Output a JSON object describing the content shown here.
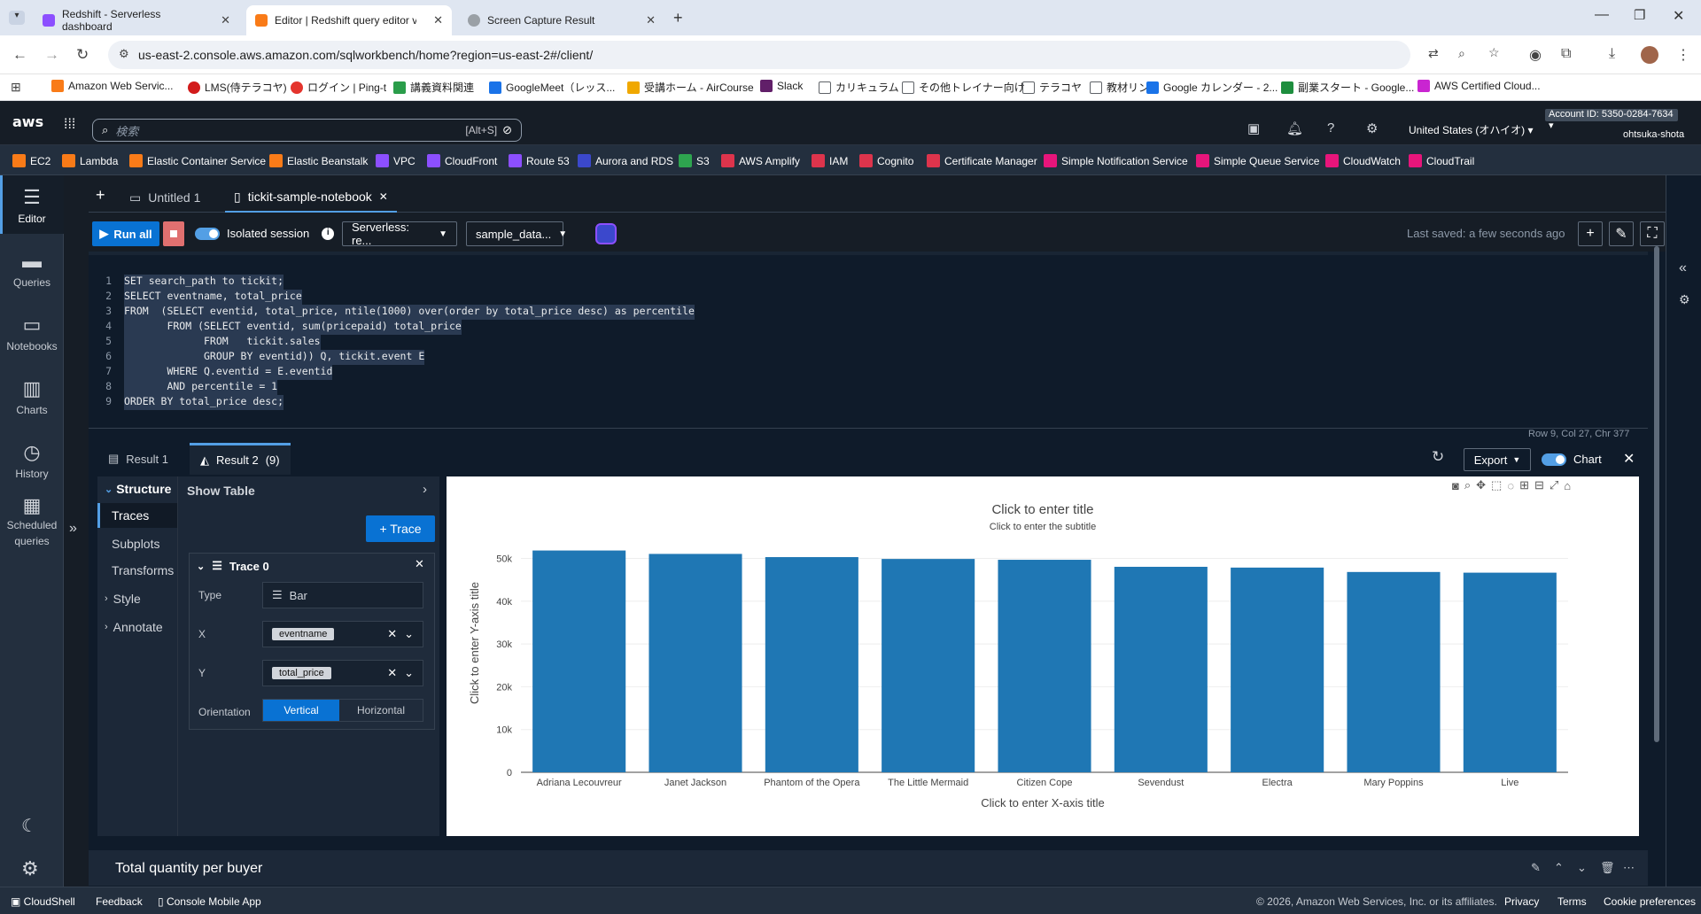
{
  "browser": {
    "tabs": [
      {
        "title": "Redshift - Serverless dashboard",
        "color": "#8c4fff"
      },
      {
        "title": "Editor | Redshift query editor v2",
        "color": "#f97b18"
      },
      {
        "title": "Screen Capture Result",
        "color": "#9aa0a6"
      }
    ],
    "url": "us-east-2.console.aws.amazon.com/sqlworkbench/home?region=us-east-2#/client/"
  },
  "bookmarks": [
    {
      "label": "Amazon Web Servic...",
      "color": "#f97b18"
    },
    {
      "label": "LMS(侍テラコヤ)",
      "color": "#d21b1b"
    },
    {
      "label": "ログイン | Ping-t",
      "color": "#e4342d"
    },
    {
      "label": "講義資料関連",
      "color": "#2a9d4a"
    },
    {
      "label": "GoogleMeet（レッス...",
      "color": "#1a73e8"
    },
    {
      "label": "受講ホーム - AirCourse",
      "color": "#f0a800"
    },
    {
      "label": "Slack",
      "color": "#611f69"
    },
    {
      "label": "カリキュラム",
      "color": "#5f6368"
    },
    {
      "label": "その他トレイナー向け",
      "color": "#5f6368"
    },
    {
      "label": "テラコヤ",
      "color": "#5f6368"
    },
    {
      "label": "教材リンク",
      "color": "#5f6368"
    },
    {
      "label": "Google カレンダー - 2...",
      "color": "#1a73e8"
    },
    {
      "label": "副業スタート - Google...",
      "color": "#1e8e3e"
    },
    {
      "label": "AWS Certified Cloud...",
      "color": "#c925d1"
    }
  ],
  "aws": {
    "search_placeholder": "検索",
    "search_shortcut": "[Alt+S]",
    "region": "United States (オハイオ) ▾",
    "account": "Account ID: 5350-0284-7634 ▾",
    "user": "ohtsuka-shota",
    "services": [
      {
        "label": "EC2",
        "color": "#f97b18"
      },
      {
        "label": "Lambda",
        "color": "#f97b18"
      },
      {
        "label": "Elastic Container Service",
        "color": "#f97b18"
      },
      {
        "label": "Elastic Beanstalk",
        "color": "#f97b18"
      },
      {
        "label": "VPC",
        "color": "#8c4fff"
      },
      {
        "label": "CloudFront",
        "color": "#8c4fff"
      },
      {
        "label": "Route 53",
        "color": "#8c4fff"
      },
      {
        "label": "Aurora and RDS",
        "color": "#3b48cc"
      },
      {
        "label": "S3",
        "color": "#2ea44f"
      },
      {
        "label": "AWS Amplify",
        "color": "#dd344c"
      },
      {
        "label": "IAM",
        "color": "#dd344c"
      },
      {
        "label": "Cognito",
        "color": "#dd344c"
      },
      {
        "label": "Certificate Manager",
        "color": "#dd344c"
      },
      {
        "label": "Simple Notification Service",
        "color": "#e7157b"
      },
      {
        "label": "Simple Queue Service",
        "color": "#e7157b"
      },
      {
        "label": "CloudWatch",
        "color": "#e7157b"
      },
      {
        "label": "CloudTrail",
        "color": "#e7157b"
      }
    ]
  },
  "rail": [
    {
      "label": "Editor",
      "icon": "☰"
    },
    {
      "label": "Queries",
      "icon": "▬"
    },
    {
      "label": "Notebooks",
      "icon": "▭"
    },
    {
      "label": "Charts",
      "icon": "▥"
    },
    {
      "label": "History",
      "icon": "◷"
    },
    {
      "label": "Scheduled queries",
      "icon": "▦"
    }
  ],
  "editor_tabs": [
    "Untitled 1",
    "tickit-sample-notebook"
  ],
  "toolbar": {
    "run_all": "Run all",
    "isolated": "Isolated session",
    "workgroup": "Serverless: re...",
    "database": "sample_data...",
    "saved": "Last saved: a few seconds ago"
  },
  "code_lines": [
    "SET search_path to tickit;",
    "SELECT eventname, total_price",
    "FROM  (SELECT eventid, total_price, ntile(1000) over(order by total_price desc) as percentile",
    "       FROM (SELECT eventid, sum(pricepaid) total_price",
    "             FROM   tickit.sales",
    "             GROUP BY eventid)) Q, tickit.event E",
    "       WHERE Q.eventid = E.eventid",
    "       AND percentile = 1",
    "ORDER BY total_price desc;"
  ],
  "cursor_status": "Row 9,  Col 27,  Chr 377",
  "results": {
    "tabs": [
      "Result 1",
      "Result 2",
      "(9)"
    ],
    "export": "Export",
    "chart_toggle": "Chart"
  },
  "structure": {
    "header": "Structure",
    "show_table": "Show Table",
    "items": [
      "Traces",
      "Subplots",
      "Transforms"
    ],
    "sections": [
      "Style",
      "Annotate"
    ],
    "add_trace": "+ Trace",
    "trace_name": "Trace 0",
    "type_label": "Type",
    "type_value": "Bar",
    "x_label": "X",
    "x_value": "eventname",
    "y_label": "Y",
    "y_value": "total_price",
    "orientation_label": "Orientation",
    "vertical": "Vertical",
    "horizontal": "Horizontal"
  },
  "chart_data": {
    "type": "bar",
    "title": "Click to enter title",
    "subtitle": "Click to enter the subtitle",
    "xlabel": "Click to enter X-axis title",
    "ylabel": "Click to enter Y-axis title",
    "categories": [
      "Adriana Lecouvreur",
      "Janet Jackson",
      "Phantom of the Opera",
      "The Little Mermaid",
      "Citizen Cope",
      "Sevendust",
      "Electra",
      "Mary Poppins",
      "Live"
    ],
    "values": [
      51846,
      51049,
      50302,
      49871,
      49679,
      48036,
      47852,
      46824,
      46664
    ],
    "ylim": [
      0,
      53000
    ],
    "yticks": [
      0,
      10000,
      20000,
      30000,
      40000,
      50000
    ],
    "ytick_labels": [
      "0",
      "10k",
      "20k",
      "30k",
      "40k",
      "50k"
    ],
    "bar_color": "#1f77b4",
    "grid": true
  },
  "next_cell": {
    "title": "Total quantity per buyer"
  },
  "footer": {
    "cloudshell": "CloudShell",
    "feedback": "Feedback",
    "mobile": "Console Mobile App",
    "copyright": "© 2026, Amazon Web Services, Inc. or its affiliates.",
    "privacy": "Privacy",
    "terms": "Terms",
    "cookies": "Cookie preferences"
  }
}
